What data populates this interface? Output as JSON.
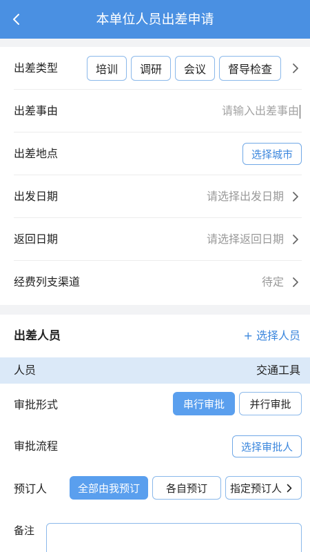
{
  "header": {
    "title": "本单位人员出差申请"
  },
  "form": {
    "trip_type": {
      "label": "出差类型",
      "options": [
        "培训",
        "调研",
        "会议",
        "督导检查"
      ]
    },
    "reason": {
      "label": "出差事由",
      "placeholder": "请输入出差事由"
    },
    "location": {
      "label": "出差地点",
      "button": "选择城市"
    },
    "depart_date": {
      "label": "出发日期",
      "placeholder": "请选择出发日期"
    },
    "return_date": {
      "label": "返回日期",
      "placeholder": "请选择返回日期"
    },
    "funding": {
      "label": "经费列支渠道",
      "value": "待定"
    }
  },
  "personnel": {
    "title": "出差人员",
    "select_link": "+ 选择人员",
    "table_head": {
      "person": "人员",
      "transport": "交通工具"
    }
  },
  "approval": {
    "mode_label": "审批形式",
    "modes": [
      "串行审批",
      "并行审批"
    ],
    "flow_label": "审批流程",
    "flow_button": "选择审批人"
  },
  "booker": {
    "label": "预订人",
    "options": [
      "全部由我预订",
      "各自预订",
      "指定预订人"
    ]
  },
  "remark": {
    "label": "备注"
  }
}
